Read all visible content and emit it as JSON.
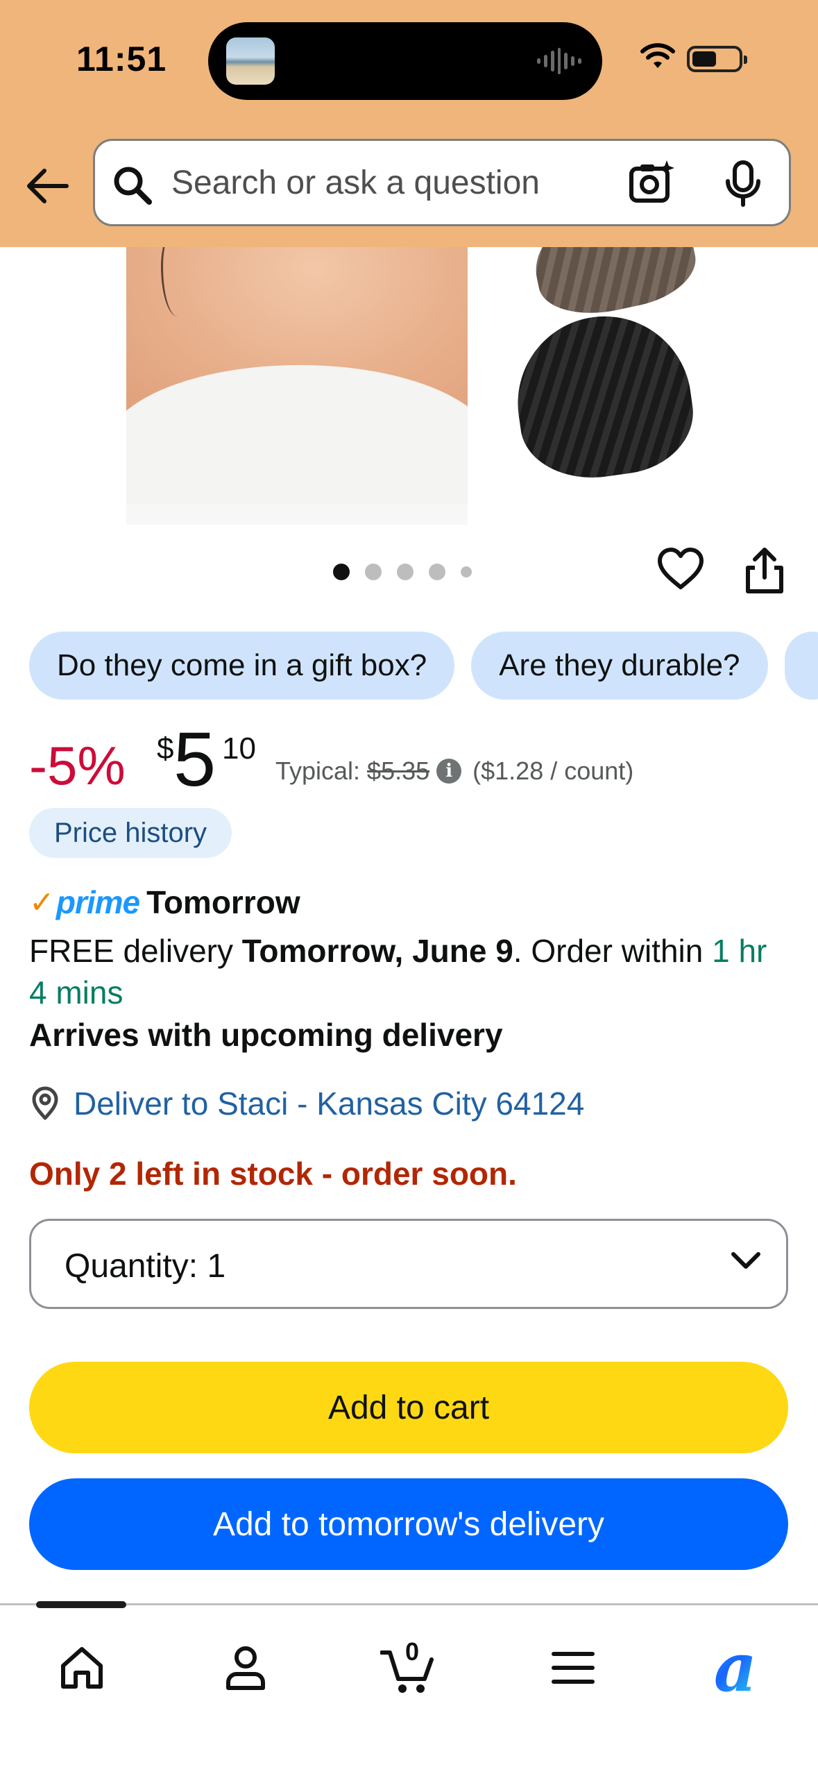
{
  "status_bar": {
    "time": "11:51"
  },
  "header": {
    "search_placeholder": "Search or ask a question",
    "icons": [
      "back-arrow-icon",
      "search-icon",
      "camera-search-icon",
      "microphone-icon"
    ]
  },
  "gallery": {
    "image_count_dots": 5,
    "active_index": 0
  },
  "chips": [
    {
      "label": "Do they come in a gift box?"
    },
    {
      "label": "Are they durable?"
    },
    {
      "label": ""
    }
  ],
  "price": {
    "discount": "-5%",
    "currency_symbol": "$",
    "whole": "5",
    "fraction": "10",
    "typical_label": "Typical:",
    "typical_price": "$5.35",
    "unit_price": "($1.28 / count)",
    "history_label": "Price history"
  },
  "delivery": {
    "prime_check": "✓",
    "prime_word": "prime",
    "prime_day": "Tomorrow",
    "free_prefix": "FREE delivery",
    "date": "Tomorrow, June 9",
    "order_within_prefix": ". Order within",
    "countdown": "1 hr 4 mins",
    "arrives": "Arrives with upcoming delivery",
    "deliver_to": "Deliver to Staci - Kansas City 64124"
  },
  "stock": {
    "message": "Only 2 left in stock - order soon."
  },
  "quantity": {
    "label": "Quantity:",
    "value": "1"
  },
  "buttons": {
    "add_to_cart": "Add to cart",
    "add_to_tomorrow": "Add to tomorrow's delivery"
  },
  "bottom_nav": {
    "cart_count": "0",
    "rufus_glyph": "a",
    "items": [
      "home-icon",
      "account-icon",
      "cart-icon",
      "menu-icon",
      "rufus-icon"
    ]
  },
  "colors": {
    "header_bg": "#efb57a",
    "chip_bg": "#cfe4fc",
    "discount_red": "#cc0c39",
    "stock_red": "#b12704",
    "countdown_green": "#067d62",
    "link_blue": "#2162a1",
    "cart_yellow": "#ffd814",
    "tomorrow_blue": "#0066ff"
  }
}
